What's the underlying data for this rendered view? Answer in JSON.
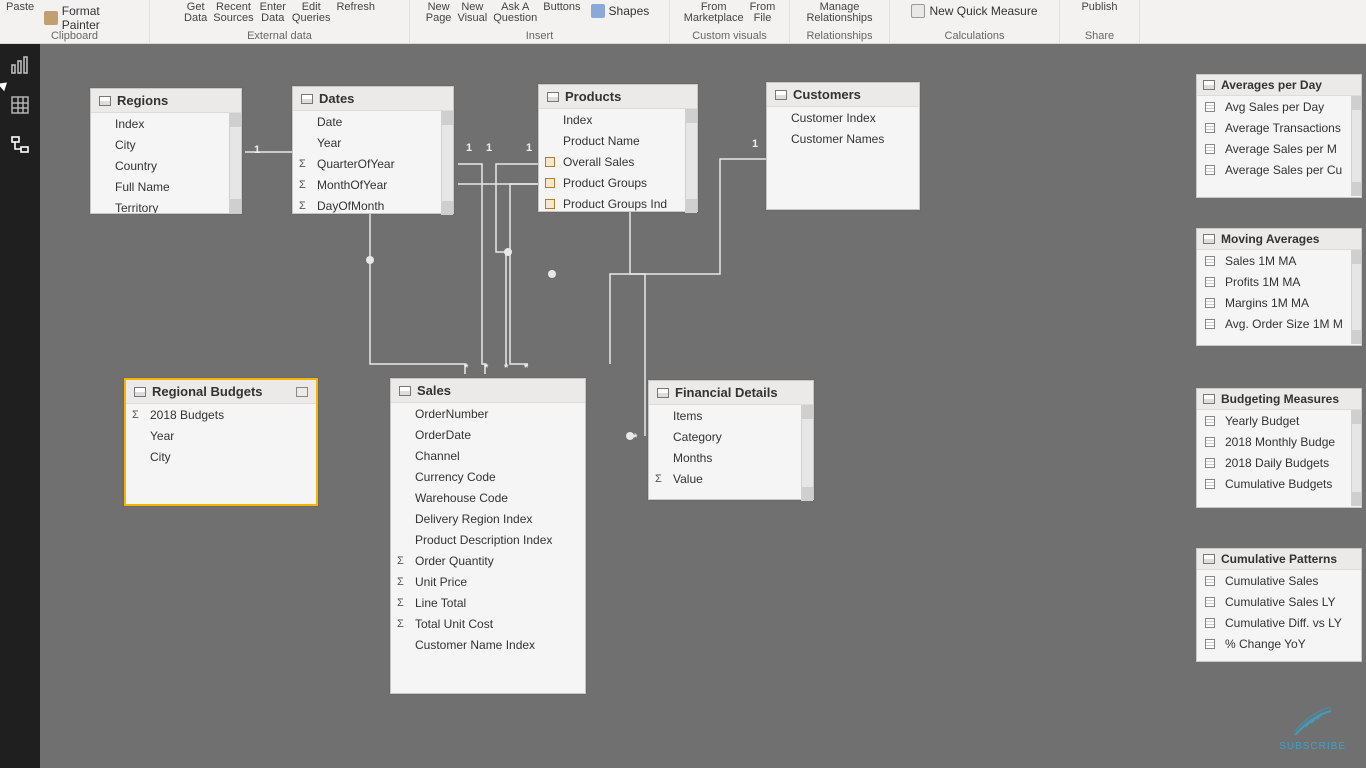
{
  "ribbon": {
    "clipboard": {
      "label": "Clipboard",
      "paste": "Paste",
      "format_painter": "Format Painter"
    },
    "external_data": {
      "label": "External data",
      "get_data": "Get\nData",
      "recent_sources": "Recent\nSources",
      "enter_data": "Enter\nData",
      "edit_queries": "Edit\nQueries",
      "refresh": "Refresh"
    },
    "insert": {
      "label": "Insert",
      "new_page": "New\nPage",
      "new_visual": "New\nVisual",
      "ask_a_question": "Ask A\nQuestion",
      "buttons": "Buttons",
      "shapes": "Shapes"
    },
    "custom_visuals": {
      "label": "Custom visuals",
      "from_marketplace": "From\nMarketplace",
      "from_file": "From\nFile"
    },
    "relationships": {
      "label": "Relationships",
      "manage": "Manage\nRelationships"
    },
    "calculations": {
      "label": "Calculations",
      "new_quick_measure": "New Quick Measure"
    },
    "share": {
      "label": "Share",
      "publish": "Publish"
    }
  },
  "tables": {
    "regions": {
      "title": "Regions",
      "fields": [
        {
          "name": "Index"
        },
        {
          "name": "City"
        },
        {
          "name": "Country"
        },
        {
          "name": "Full Name"
        },
        {
          "name": "Territory"
        }
      ]
    },
    "dates": {
      "title": "Dates",
      "fields": [
        {
          "name": "Date"
        },
        {
          "name": "Year"
        },
        {
          "name": "QuarterOfYear",
          "agg": true
        },
        {
          "name": "MonthOfYear",
          "agg": true
        },
        {
          "name": "DayOfMonth",
          "agg": true
        }
      ]
    },
    "products": {
      "title": "Products",
      "fields": [
        {
          "name": "Index"
        },
        {
          "name": "Product Name"
        },
        {
          "name": "Overall Sales",
          "calc": true
        },
        {
          "name": "Product Groups",
          "calc": true
        },
        {
          "name": "Product Groups Ind",
          "calc": true
        }
      ]
    },
    "customers": {
      "title": "Customers",
      "fields": [
        {
          "name": "Customer Index"
        },
        {
          "name": "Customer Names"
        }
      ]
    },
    "regional_budgets": {
      "title": "Regional Budgets",
      "fields": [
        {
          "name": "2018 Budgets",
          "agg": true
        },
        {
          "name": "Year"
        },
        {
          "name": "City"
        }
      ]
    },
    "sales": {
      "title": "Sales",
      "fields": [
        {
          "name": "OrderNumber"
        },
        {
          "name": "OrderDate"
        },
        {
          "name": "Channel"
        },
        {
          "name": "Currency Code"
        },
        {
          "name": "Warehouse Code"
        },
        {
          "name": "Delivery Region Index"
        },
        {
          "name": "Product Description Index"
        },
        {
          "name": "Order Quantity",
          "agg": true
        },
        {
          "name": "Unit Price",
          "agg": true
        },
        {
          "name": "Line Total",
          "agg": true
        },
        {
          "name": "Total Unit Cost",
          "agg": true
        },
        {
          "name": "Customer Name Index"
        }
      ]
    },
    "financial_details": {
      "title": "Financial Details",
      "fields": [
        {
          "name": "Items"
        },
        {
          "name": "Category"
        },
        {
          "name": "Months"
        },
        {
          "name": "Value",
          "agg": true
        }
      ]
    }
  },
  "measure_groups": {
    "averages_per_day": {
      "title": "Averages per Day",
      "items": [
        "Avg Sales per Day",
        "Average Transactions",
        "Average Sales per M",
        "Average Sales per Cu"
      ]
    },
    "moving_averages": {
      "title": "Moving Averages",
      "items": [
        "Sales 1M MA",
        "Profits 1M MA",
        "Margins 1M MA",
        "Avg. Order Size 1M M"
      ]
    },
    "budgeting_measures": {
      "title": "Budgeting Measures",
      "items": [
        "Yearly Budget",
        "2018 Monthly Budge",
        "2018 Daily Budgets",
        "Cumulative Budgets"
      ]
    },
    "cumulative_patterns": {
      "title": "Cumulative Patterns",
      "items": [
        "Cumulative Sales",
        "Cumulative Sales LY",
        "Cumulative Diff. vs LY",
        "% Change YoY"
      ]
    }
  },
  "relationship_cardinality": {
    "one": "1",
    "many": "*"
  },
  "watermark": {
    "text": "SUBSCRIBE"
  }
}
